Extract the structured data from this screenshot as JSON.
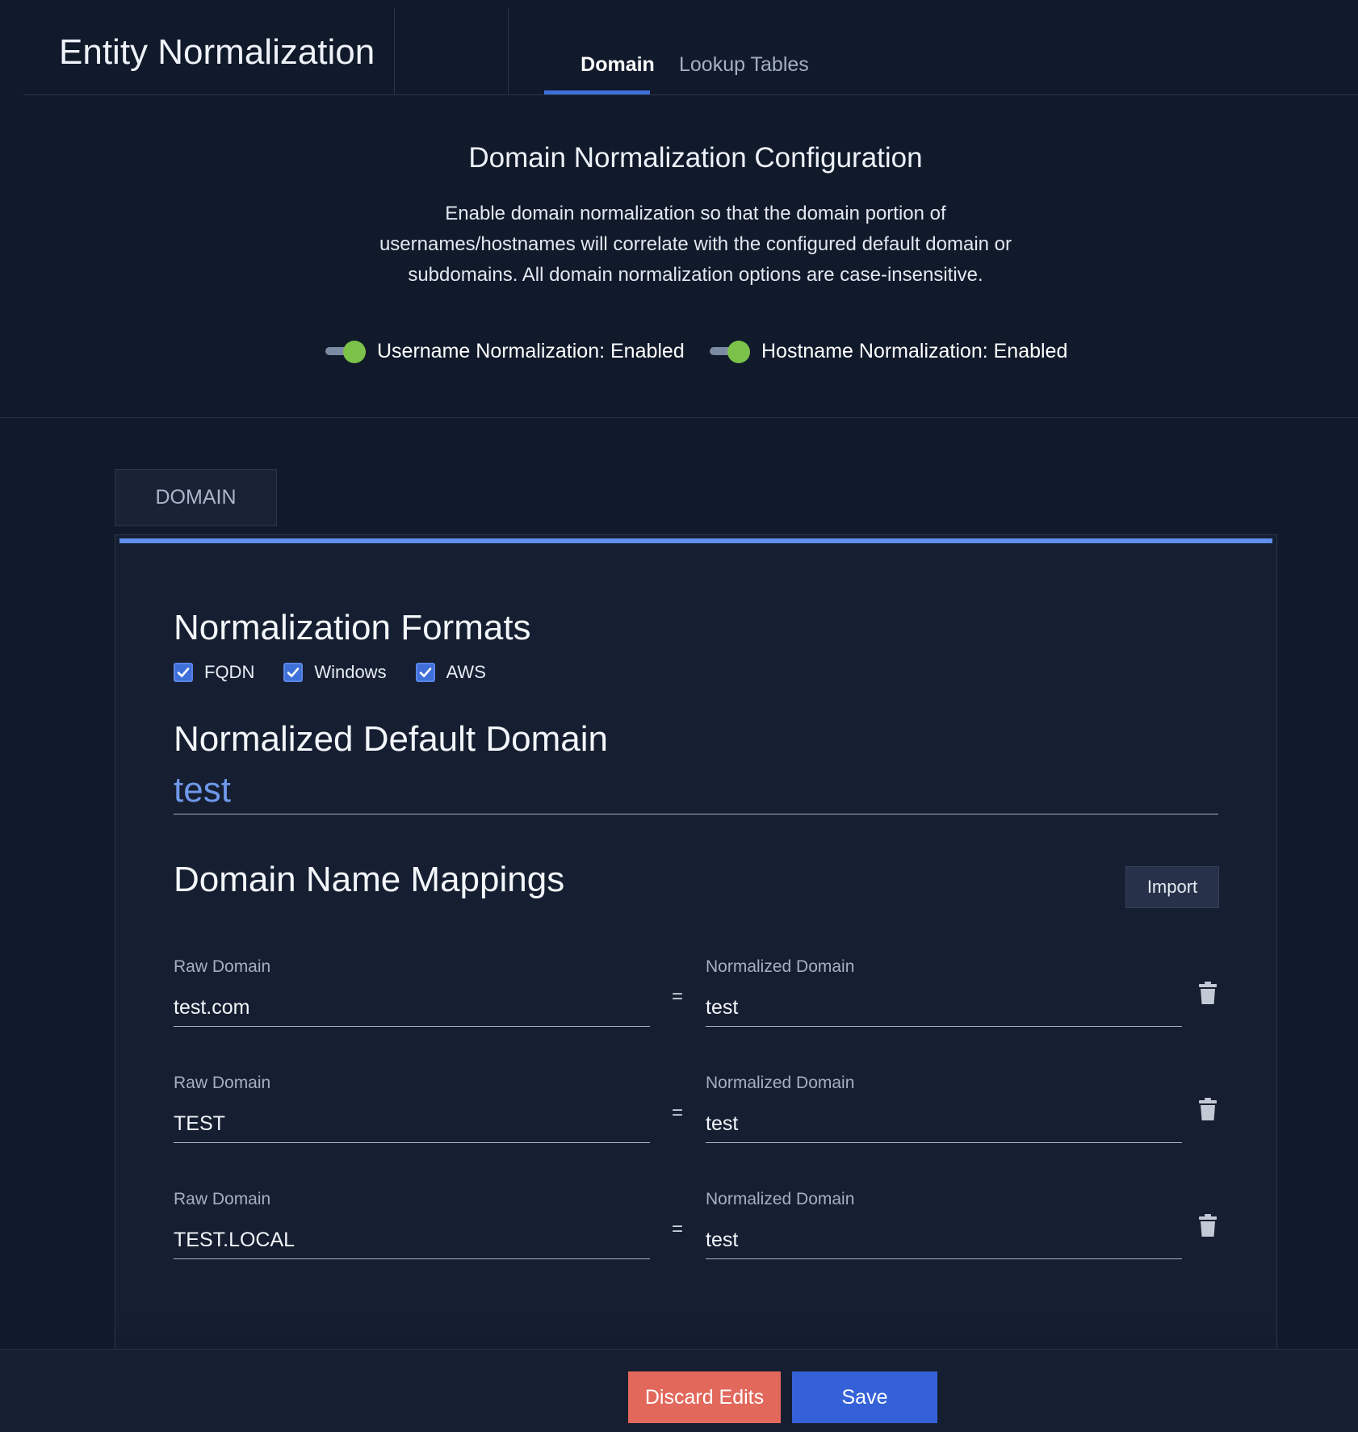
{
  "header": {
    "title": "Entity Normalization",
    "tabs": [
      {
        "label": "Domain",
        "active": true
      },
      {
        "label": "Lookup Tables",
        "active": false
      }
    ]
  },
  "config": {
    "title": "Domain Normalization Configuration",
    "description_lines": [
      "Enable domain normalization so that the domain portion of",
      "usernames/hostnames will correlate with the configured default domain or",
      "subdomains. All domain normalization options are case-insensitive."
    ],
    "toggles": [
      {
        "label": "Username Normalization: Enabled",
        "on": true
      },
      {
        "label": "Hostname Normalization: Enabled",
        "on": true
      }
    ]
  },
  "panel": {
    "tab_label": "DOMAIN",
    "formats_heading": "Normalization Formats",
    "formats": [
      {
        "label": "FQDN",
        "checked": true
      },
      {
        "label": "Windows",
        "checked": true
      },
      {
        "label": "AWS",
        "checked": true
      }
    ],
    "default_domain_heading": "Normalized Default Domain",
    "default_domain_value": "test",
    "mappings_heading": "Domain Name Mappings",
    "import_label": "Import",
    "raw_label": "Raw Domain",
    "normalized_label": "Normalized Domain",
    "equals": "=",
    "mappings": [
      {
        "raw": "test.com",
        "normalized": "test"
      },
      {
        "raw": "TEST",
        "normalized": "test"
      },
      {
        "raw": "TEST.LOCAL",
        "normalized": "test"
      }
    ]
  },
  "footer": {
    "discard_label": "Discard Edits",
    "save_label": "Save"
  },
  "colors": {
    "background": "#111a2b",
    "panel": "#161f31",
    "accent_blue": "#3f6fd8",
    "toggle_on": "#7cc24a",
    "discard": "#e2685c",
    "save": "#3561d8",
    "link_value": "#6f98ea"
  },
  "icons": {
    "check": "check-icon",
    "delete": "trash-icon"
  }
}
